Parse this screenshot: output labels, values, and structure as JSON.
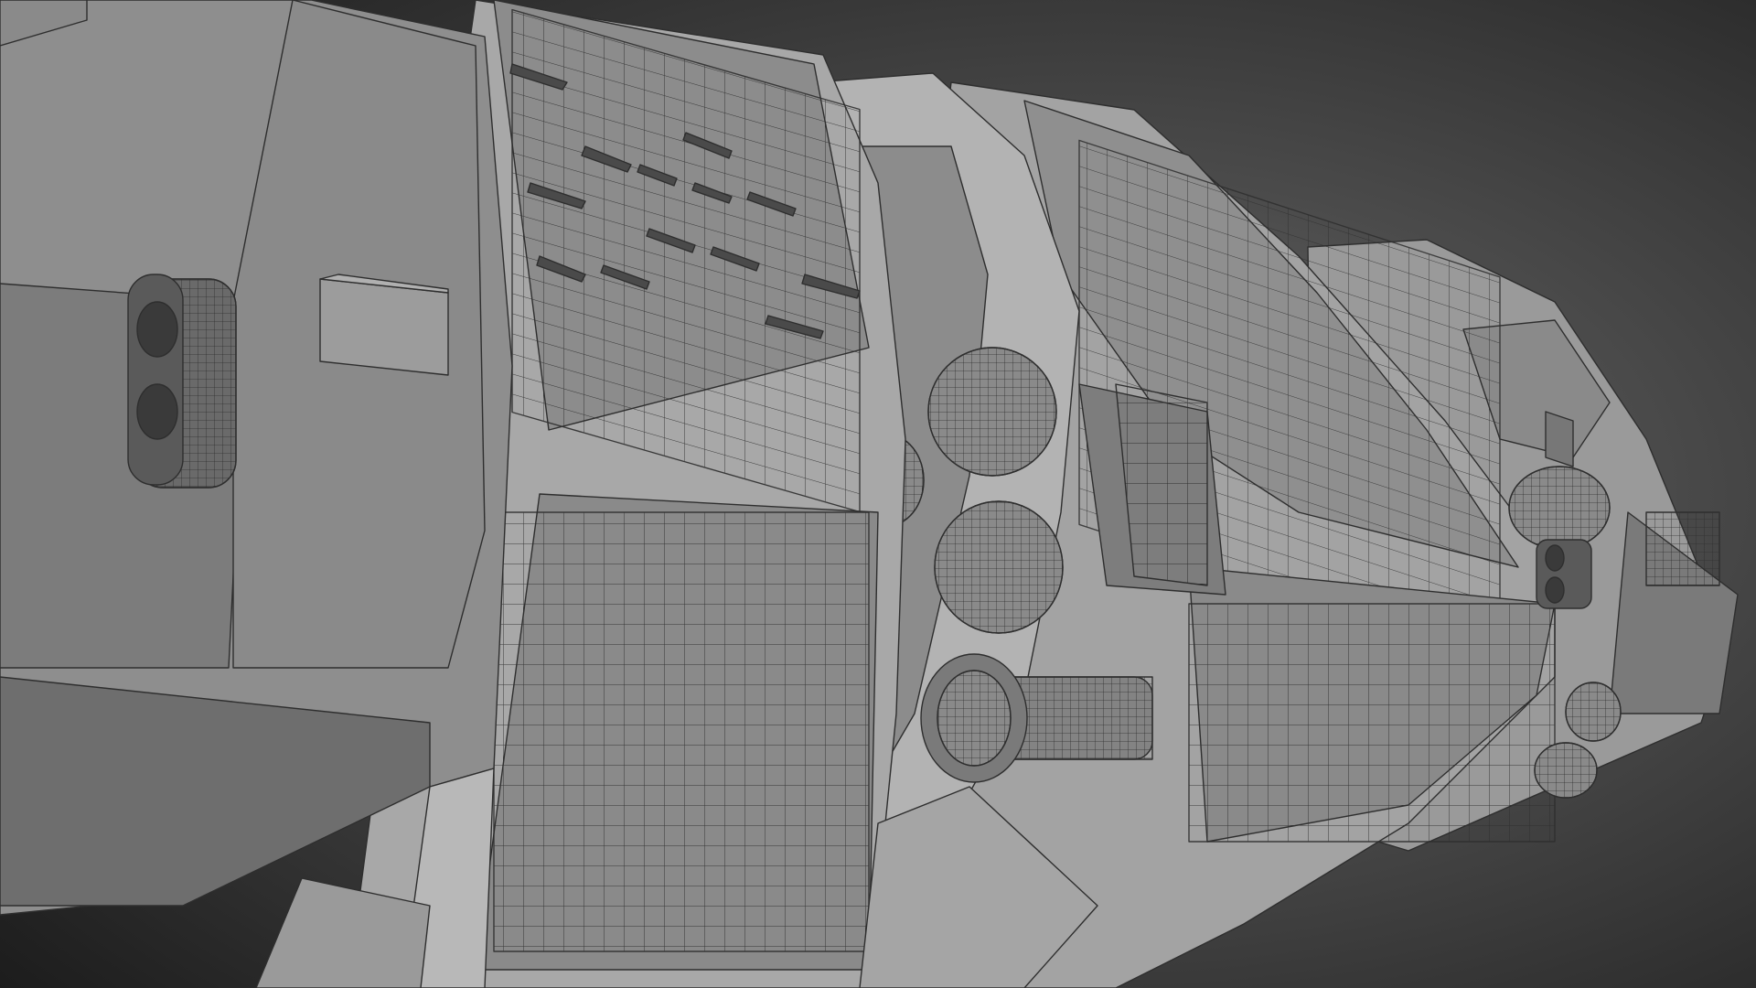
{
  "scene": {
    "render_mode": "wireframe-on-shaded",
    "background": {
      "outer": "#1c1c1c",
      "inner": "#6a6a6a"
    },
    "materials": {
      "hull_dark": "#707070",
      "hull_mid": "#8a8a8a",
      "hull_light": "#a6a6a6",
      "hull_frame": "#bcbcbc",
      "panel_shadow": "#4a4a4a",
      "wire": "#2e2e2e"
    }
  }
}
